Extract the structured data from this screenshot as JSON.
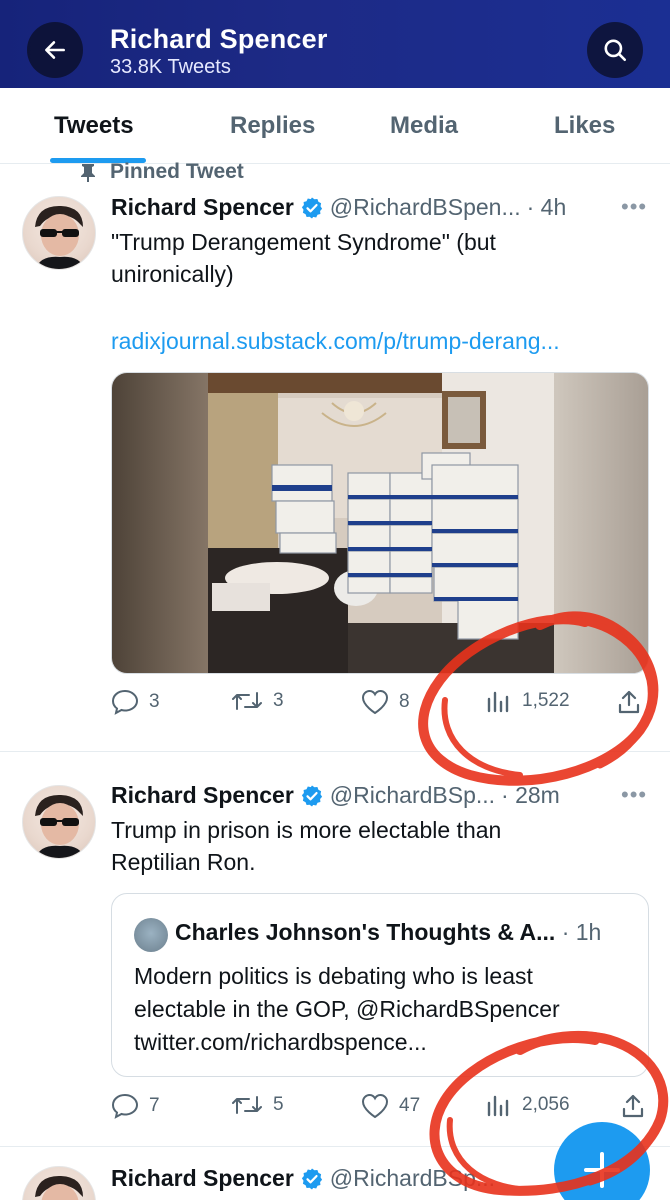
{
  "header": {
    "title": "Richard Spencer",
    "subtitle": "33.8K Tweets"
  },
  "tabs": [
    {
      "label": "Tweets"
    },
    {
      "label": "Replies"
    },
    {
      "label": "Media"
    },
    {
      "label": "Likes"
    }
  ],
  "tweets": [
    {
      "pinned_label": "Pinned Tweet",
      "name": "Richard Spencer",
      "handle": "@RichardBSpen...",
      "time": "· 4h",
      "text_line1": "\"Trump Derangement Syndrome\" (but",
      "text_line2": "unironically)",
      "link": "radixjournal.substack.com/p/trump-derang...",
      "replies": "3",
      "retweets": "3",
      "likes": "8",
      "views": "1,522"
    },
    {
      "name": "Richard Spencer",
      "handle": "@RichardBSp...",
      "time": "· 28m",
      "text_line1": "Trump in prison is more electable than",
      "text_line2": "Reptilian Ron.",
      "quote": {
        "name": "Charles Johnson's Thoughts & A...",
        "time": "· 1h",
        "line1": "Modern politics is debating who is least",
        "line2": "electable in the GOP, @RichardBSpencer",
        "line3": "twitter.com/richardbspence..."
      },
      "replies": "7",
      "retweets": "5",
      "likes": "47",
      "views": "2,056"
    },
    {
      "name": "Richard Spencer",
      "handle": "@RichardBSp..."
    }
  ],
  "colors": {
    "accent": "#1d9bf0",
    "header_bg": "#1b2a8a",
    "annotation": "#e8321c",
    "muted": "#536471"
  }
}
